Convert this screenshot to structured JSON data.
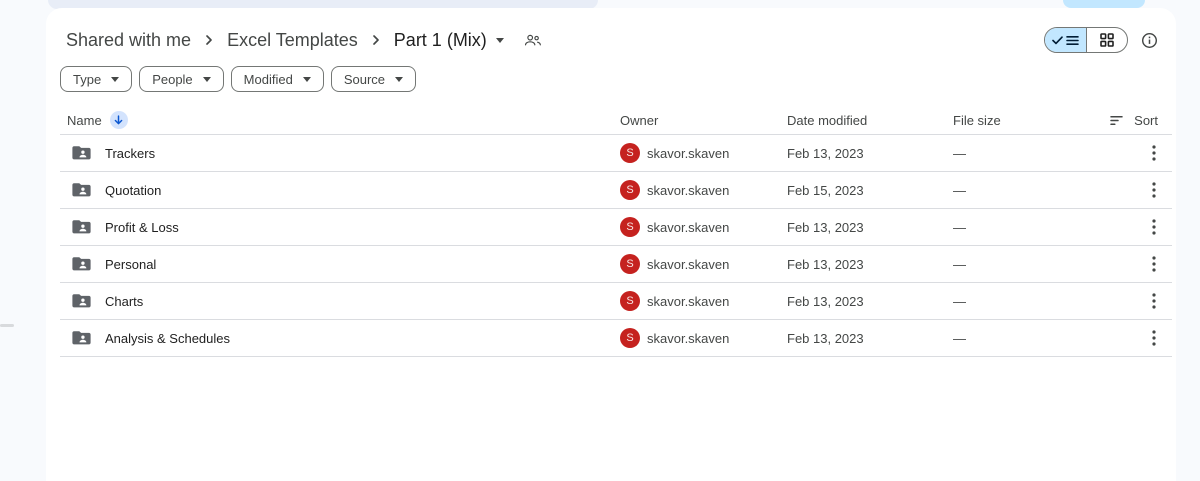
{
  "breadcrumb": {
    "items": [
      "Shared with me",
      "Excel Templates",
      "Part 1 (Mix)"
    ]
  },
  "filters": {
    "type": "Type",
    "people": "People",
    "modified": "Modified",
    "source": "Source"
  },
  "table": {
    "headers": {
      "name": "Name",
      "owner": "Owner",
      "date_modified": "Date modified",
      "file_size": "File size",
      "sort": "Sort"
    },
    "rows": [
      {
        "name": "Trackers",
        "avatar_letter": "S",
        "owner": "skavor.skaven",
        "modified": "Feb 13, 2023",
        "size": "—"
      },
      {
        "name": "Quotation",
        "avatar_letter": "S",
        "owner": "skavor.skaven",
        "modified": "Feb 15, 2023",
        "size": "—"
      },
      {
        "name": "Profit & Loss",
        "avatar_letter": "S",
        "owner": "skavor.skaven",
        "modified": "Feb 13, 2023",
        "size": "—"
      },
      {
        "name": "Personal",
        "avatar_letter": "S",
        "owner": "skavor.skaven",
        "modified": "Feb 13, 2023",
        "size": "—"
      },
      {
        "name": "Charts",
        "avatar_letter": "S",
        "owner": "skavor.skaven",
        "modified": "Feb 13, 2023",
        "size": "—"
      },
      {
        "name": "Analysis & Schedules",
        "avatar_letter": "S",
        "owner": "skavor.skaven",
        "modified": "Feb 13, 2023",
        "size": "—"
      }
    ]
  },
  "icons": {
    "view_list": "list-view-icon",
    "view_grid": "grid-view-icon",
    "info": "info-icon",
    "people": "people-icon",
    "sort_arrow": "arrow-down-icon"
  },
  "colors": {
    "accent_blue": "#0b57d0",
    "selected_segment": "#c2e7ff",
    "avatar_red": "#c5221f",
    "folder_gray": "#5f6368",
    "page_bg": "#f8fafd"
  }
}
